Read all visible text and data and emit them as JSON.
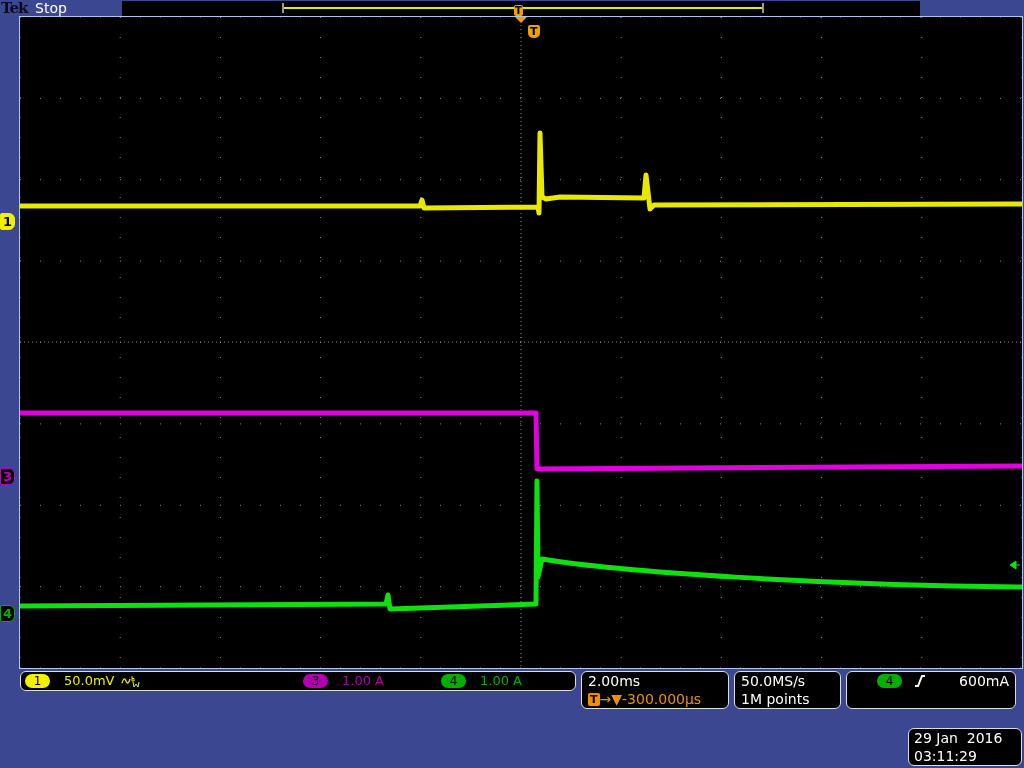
{
  "top_bar": {
    "brand": "Tek",
    "status": "Stop"
  },
  "record_view": {
    "trigger_label": "T"
  },
  "trigger_marker": {
    "label": "T"
  },
  "channel_markers": [
    {
      "label": "1",
      "color": "#f0f000",
      "selected": true
    },
    {
      "label": "3",
      "color": "#c000c0",
      "selected": false
    },
    {
      "label": "4",
      "color": "#00b000",
      "selected": false
    }
  ],
  "channels": [
    {
      "badge": "1",
      "scale": "50.0mV",
      "color": "#f0f000",
      "bandwidth_limited": true
    },
    {
      "badge": "3",
      "scale": "1.00 A",
      "color": "#b000b0",
      "bandwidth_limited": false
    },
    {
      "badge": "4",
      "scale": "1.00 A",
      "color": "#00b000",
      "bandwidth_limited": false
    }
  ],
  "horizontal": {
    "scale": "2.00ms",
    "trigger_icon": "T",
    "arrow": "→▼",
    "delay": "-300.000µs"
  },
  "acquisition": {
    "sample_rate": "50.0MS/s",
    "record_length": "1M points"
  },
  "trigger": {
    "source": "4",
    "color": "#00b000",
    "slope_rising": true,
    "level": "600mA"
  },
  "date": "29 Jan  2016",
  "time": "03:11:29"
}
